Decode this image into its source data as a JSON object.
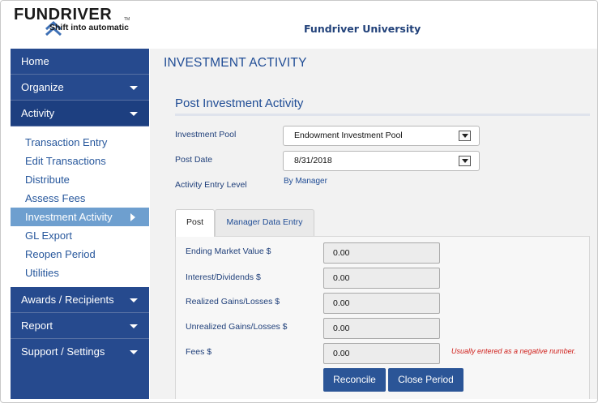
{
  "header": {
    "logo_word": "FUNDRIVER",
    "logo_tm": "TM",
    "logo_tagline": "Shift into automatic",
    "organization": "Fundriver University"
  },
  "sidebar": {
    "home": "Home",
    "organize": "Organize",
    "activity": "Activity",
    "activity_items": [
      "Transaction Entry",
      "Edit Transactions",
      "Distribute",
      "Assess Fees",
      "Investment Activity",
      "GL Export",
      "Reopen Period",
      "Utilities"
    ],
    "selected_item": "Investment Activity",
    "awards": "Awards / Recipients",
    "report": "Report",
    "support": "Support / Settings"
  },
  "main": {
    "page_title": "INVESTMENT ACTIVITY",
    "section_title": "Post Investment Activity",
    "investment_pool_label": "Investment Pool",
    "investment_pool_value": "Endowment Investment Pool",
    "post_date_label": "Post Date",
    "post_date_value": "8/31/2018",
    "entry_level_label": "Activity Entry Level",
    "entry_level_value": "By Manager",
    "tabs": [
      "Post",
      "Manager Data Entry"
    ],
    "fields": [
      {
        "label": "Ending Market Value $",
        "value": "0.00"
      },
      {
        "label": "Interest/Dividends $",
        "value": "0.00"
      },
      {
        "label": "Realized Gains/Losses $",
        "value": "0.00"
      },
      {
        "label": "Unrealized Gains/Losses $",
        "value": "0.00"
      },
      {
        "label": "Fees $",
        "value": "0.00"
      }
    ],
    "fees_hint": "Usually entered as a negative number.",
    "reconcile_label": "Reconcile",
    "close_period_label": "Close Period"
  },
  "colors": {
    "nav_blue": "#264a8e",
    "selected_item": "#6e9fcf",
    "link_blue": "#27579c",
    "hint_red": "#d0201c"
  }
}
